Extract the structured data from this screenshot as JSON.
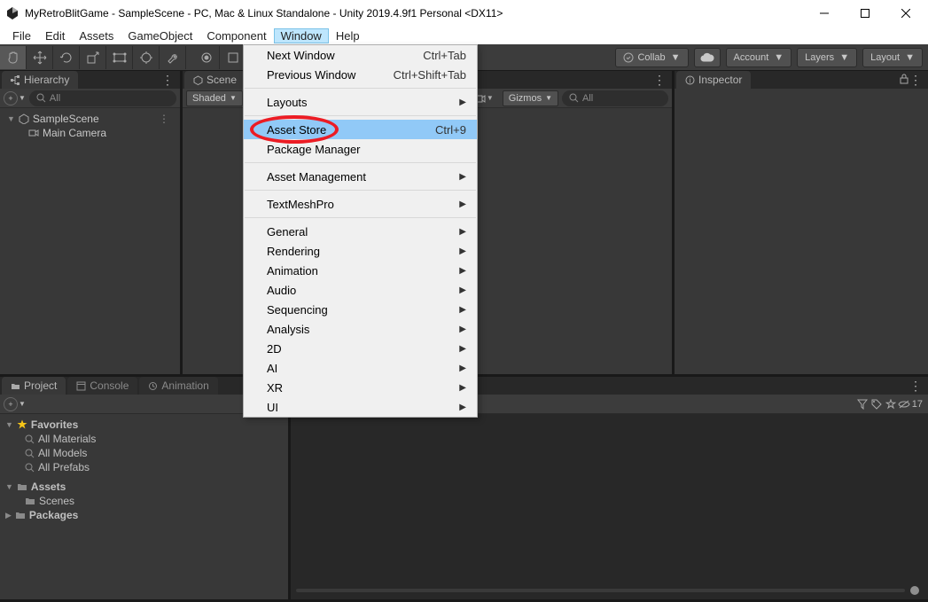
{
  "title": "MyRetroBlitGame - SampleScene - PC, Mac & Linux Standalone - Unity 2019.4.9f1 Personal <DX11>",
  "menubar": [
    "File",
    "Edit",
    "Assets",
    "GameObject",
    "Component",
    "Window",
    "Help"
  ],
  "menubar_open_index": 5,
  "window_menu": {
    "groups": [
      [
        {
          "label": "Next Window",
          "shortcut": "Ctrl+Tab"
        },
        {
          "label": "Previous Window",
          "shortcut": "Ctrl+Shift+Tab"
        }
      ],
      [
        {
          "label": "Layouts",
          "submenu": true
        }
      ],
      [
        {
          "label": "Asset Store",
          "shortcut": "Ctrl+9",
          "highlight": true
        },
        {
          "label": "Package Manager"
        }
      ],
      [
        {
          "label": "Asset Management",
          "submenu": true
        }
      ],
      [
        {
          "label": "TextMeshPro",
          "submenu": true
        }
      ],
      [
        {
          "label": "General",
          "submenu": true
        },
        {
          "label": "Rendering",
          "submenu": true
        },
        {
          "label": "Animation",
          "submenu": true
        },
        {
          "label": "Audio",
          "submenu": true
        },
        {
          "label": "Sequencing",
          "submenu": true
        },
        {
          "label": "Analysis",
          "submenu": true
        },
        {
          "label": "2D",
          "submenu": true
        },
        {
          "label": "AI",
          "submenu": true
        },
        {
          "label": "XR",
          "submenu": true
        },
        {
          "label": "UI",
          "submenu": true
        }
      ]
    ]
  },
  "topbuttons": {
    "collab": "Collab",
    "account": "Account",
    "layers": "Layers",
    "layout": "Layout"
  },
  "hierarchy": {
    "tab": "Hierarchy",
    "search_placeholder": "All",
    "scene": "SampleScene",
    "items": [
      "Main Camera"
    ]
  },
  "scene": {
    "tab": "Scene",
    "shading": "Shaded",
    "gizmos": "Gizmos",
    "search_placeholder": "All"
  },
  "inspector": {
    "tab": "Inspector"
  },
  "project": {
    "tabs": [
      "Project",
      "Console",
      "Animation"
    ],
    "favorites": "Favorites",
    "fav_items": [
      "All Materials",
      "All Models",
      "All Prefabs"
    ],
    "assets": "Assets",
    "assets_children": [
      "Scenes"
    ],
    "packages": "Packages"
  },
  "preview": {
    "hidden_count": "17"
  }
}
